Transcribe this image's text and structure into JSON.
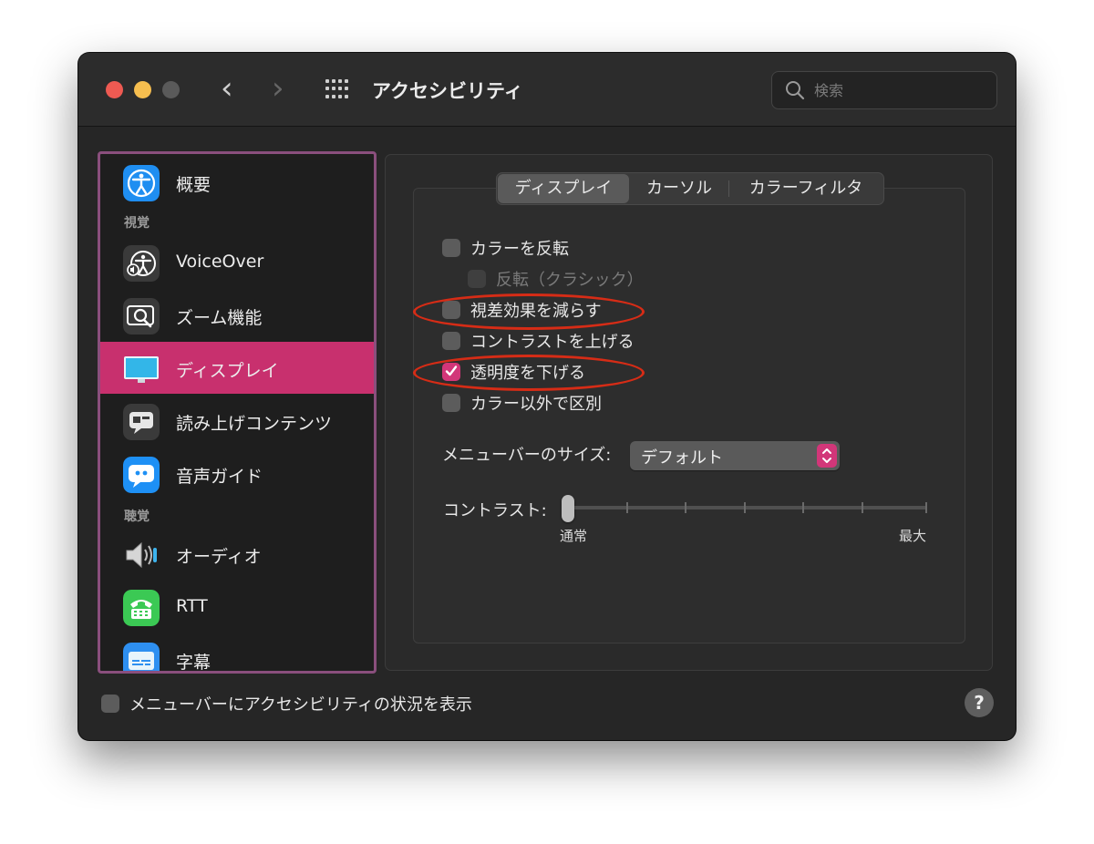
{
  "window": {
    "title": "アクセシビリティ",
    "search_placeholder": "検索"
  },
  "sidebar": {
    "sections": [
      "視覚",
      "聴覚"
    ],
    "items": [
      {
        "label": "概要",
        "icon": "accessibility-icon"
      },
      {
        "label": "VoiceOver",
        "icon": "voiceover-icon"
      },
      {
        "label": "ズーム機能",
        "icon": "zoom-icon"
      },
      {
        "label": "ディスプレイ",
        "icon": "display-icon",
        "selected": true
      },
      {
        "label": "読み上げコンテンツ",
        "icon": "spoken-content-icon"
      },
      {
        "label": "音声ガイド",
        "icon": "descriptions-icon"
      },
      {
        "label": "オーディオ",
        "icon": "audio-icon"
      },
      {
        "label": "RTT",
        "icon": "rtt-icon"
      },
      {
        "label": "字幕",
        "icon": "captions-icon"
      }
    ]
  },
  "tabs": [
    {
      "label": "ディスプレイ",
      "active": true
    },
    {
      "label": "カーソル",
      "active": false
    },
    {
      "label": "カラーフィルタ",
      "active": false
    }
  ],
  "checkboxes": [
    {
      "label": "カラーを反転",
      "checked": false,
      "enabled": true
    },
    {
      "label": "反転（クラシック）",
      "checked": false,
      "enabled": false
    },
    {
      "label": "視差効果を減らす",
      "checked": false,
      "enabled": true
    },
    {
      "label": "コントラストを上げる",
      "checked": false,
      "enabled": true
    },
    {
      "label": "透明度を下げる",
      "checked": true,
      "enabled": true
    },
    {
      "label": "カラー以外で区別",
      "checked": false,
      "enabled": true
    }
  ],
  "menu_bar_size": {
    "label": "メニューバーのサイズ:",
    "value": "デフォルト"
  },
  "contrast": {
    "label": "コントラスト:",
    "min_label": "通常",
    "max_label": "最大",
    "value": 0
  },
  "bottom": {
    "show_status_label": "メニューバーにアクセシビリティの状況を表示",
    "show_status_checked": false,
    "help_label": "?"
  },
  "colors": {
    "accent": "#d23679",
    "selection": "#c8306e",
    "annotation": "#d62c16",
    "sidebar_border": "#8a4f7d"
  }
}
